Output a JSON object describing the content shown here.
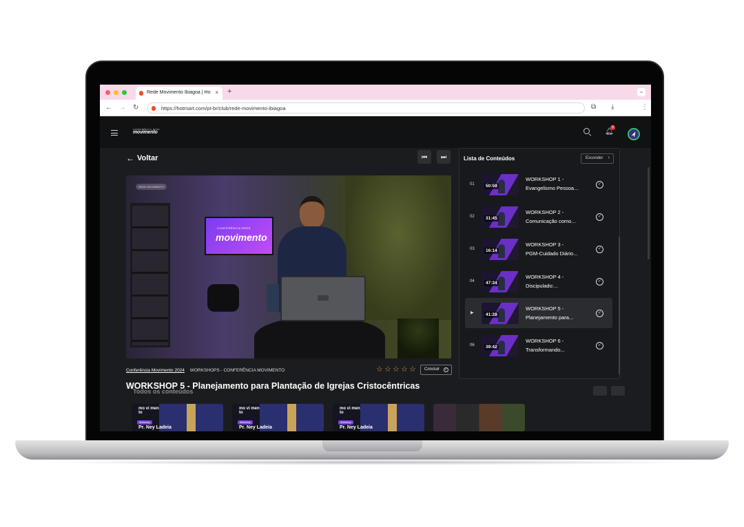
{
  "browser": {
    "tab_title": "Rede Movimento Ibiagoa | Ho",
    "tab_close": "×",
    "new_tab": "+",
    "url": "https://hotmart.com/pt-br/club/rede-movimento-ibiagoa"
  },
  "header": {
    "logo_small": "CONFERÊNCIA REDE",
    "logo": "movimento",
    "notification_count": "0"
  },
  "player": {
    "back_label": "Voltar",
    "prev_icon": "skip-back-icon",
    "next_icon": "skip-forward-icon",
    "video_tag": "REDE MOVIMENTO",
    "tv_small": "CONFERÊNCIA REDE",
    "tv_text": "movimento"
  },
  "meta": {
    "breadcrumb_course": "Conferência Movimento 2024",
    "breadcrumb_module": "WORKSHOPS - CONFERÊNCIA MOVIMENTO",
    "rating_stars": 0,
    "complete_label": "Concluir",
    "lesson_title": "WORKSHOP 5 - Planejamento para Plantação de Igrejas Cristocêntricas",
    "section_title": "Todos os conteúdos"
  },
  "thumbnails": [
    {
      "text": "mo vi men to",
      "badge": "Workshop",
      "name": "Pr. Ney Ladeia"
    },
    {
      "text": "mo vi men to",
      "badge": "Workshop",
      "name": "Pr. Ney Ladeia"
    },
    {
      "text": "mo vi men to",
      "badge": "Workshop",
      "name": "Pr. Ney Ladeia"
    },
    {
      "text": "",
      "badge": "",
      "name": ""
    }
  ],
  "sidebar": {
    "title": "Lista de Conteúdos",
    "hide_label": "Esconder",
    "items": [
      {
        "num": "01",
        "duration": "50:59",
        "line1": "WORKSHOP 1 -",
        "line2": "Evangelismo Pessoa...",
        "active": false
      },
      {
        "num": "02",
        "duration": "31:45",
        "line1": "WORKSHOP 2 -",
        "line2": "Comunicação como...",
        "active": false
      },
      {
        "num": "03",
        "duration": "16:14",
        "line1": "WORKSHOP 3 -",
        "line2": "PGM-Cuidado Diário...",
        "active": false
      },
      {
        "num": "04",
        "duration": "47:34",
        "line1": "WORKSHOP 4 -",
        "line2": "Discipulado:...",
        "active": false
      },
      {
        "num": "",
        "duration": "41:28",
        "line1": "WORKSHOP 5 -",
        "line2": "Planejamento para...",
        "active": true
      },
      {
        "num": "06",
        "duration": "39:42",
        "line1": "WORKSHOP 6 -",
        "line2": "Transformando...",
        "active": false
      }
    ]
  },
  "colors": {
    "accent": "#7b3df0",
    "star": "#d9a23a",
    "badge": "#e53935",
    "avatar_ring": "#2fbf71"
  }
}
